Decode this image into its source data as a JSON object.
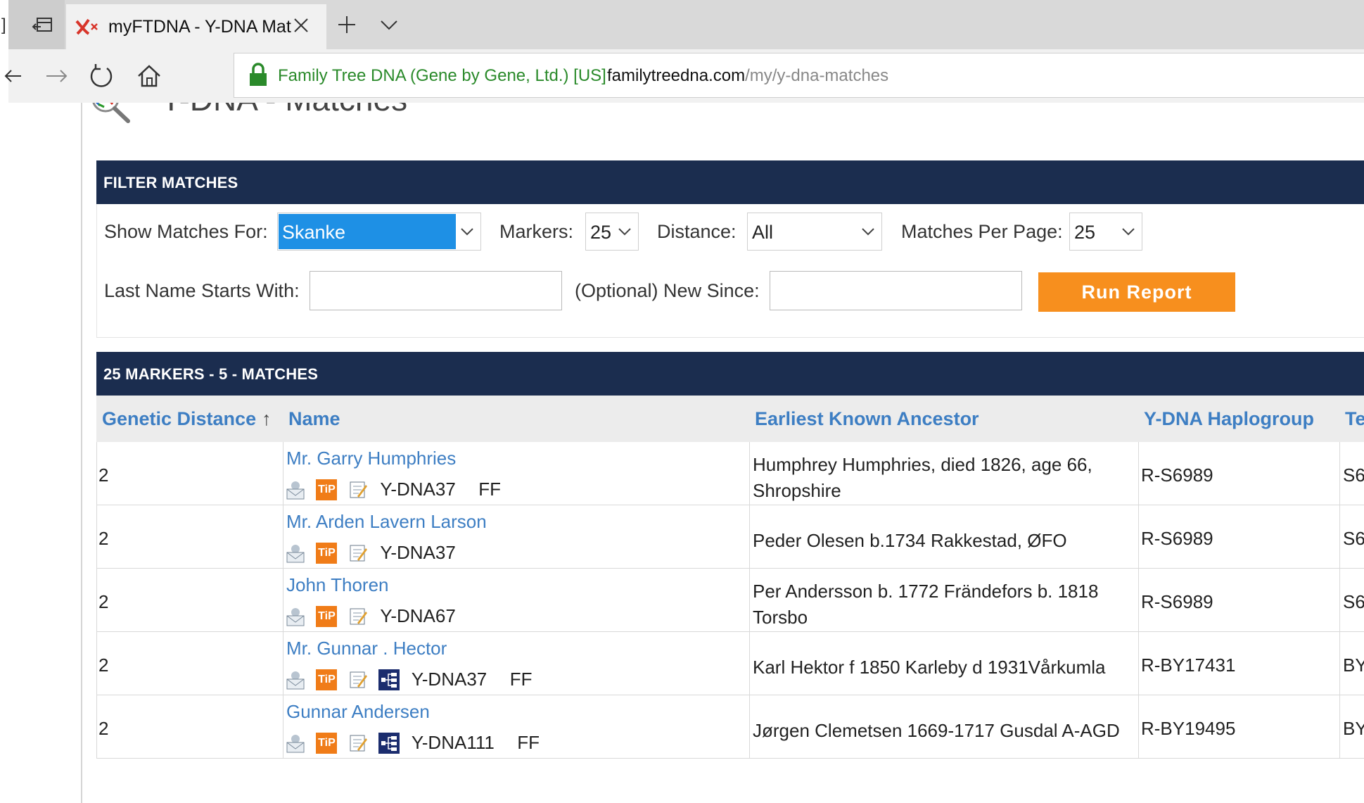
{
  "browser": {
    "tab_title": "myFTDNA - Y-DNA Mat",
    "site_identity": "Family Tree DNA (Gene by Gene, Ltd.) [US]",
    "url_host": "familytreedna.com",
    "url_path": "/my/y-dna-matches"
  },
  "page": {
    "heading_fragment": "Y-DNA - Matches"
  },
  "filter": {
    "title": "FILTER MATCHES",
    "show_matches_label": "Show Matches For:",
    "show_matches_value": "Skanke",
    "markers_label": "Markers:",
    "markers_value": "25",
    "distance_label": "Distance:",
    "distance_value": "All",
    "per_page_label": "Matches Per Page:",
    "per_page_value": "25",
    "last_name_label": "Last Name Starts With:",
    "last_name_value": "",
    "new_since_label": "(Optional) New Since:",
    "new_since_value": "",
    "run_label": "Run Report"
  },
  "results": {
    "title": "25 MARKERS - 5 - MATCHES",
    "columns": {
      "genetic_distance": "Genetic Distance",
      "sort_indicator": "↑",
      "name": "Name",
      "eka": "Earliest Known Ancestor",
      "haplogroup": "Y-DNA Haplogroup",
      "terminal_snp": "Te"
    },
    "rows": [
      {
        "gd": "2",
        "name": "Mr. Garry Humphries",
        "kit": "Y-DNA37",
        "ff": "FF",
        "eka": "Humphrey Humphries, died 1826, age 66, Shropshire",
        "haplogroup": "R-S6989",
        "te": "S6"
      },
      {
        "gd": "2",
        "name": "Mr. Arden Lavern Larson",
        "kit": "Y-DNA37",
        "ff": "",
        "eka": "Peder Olesen b.1734 Rakkestad, ØFO",
        "haplogroup": "R-S6989",
        "te": "S6"
      },
      {
        "gd": "2",
        "name": "John Thoren",
        "kit": "Y-DNA67",
        "ff": "",
        "eka": "Per Andersson b. 1772 Frändefors b. 1818 Torsbo",
        "haplogroup": "R-S6989",
        "te": "S6"
      },
      {
        "gd": "2",
        "name": "Mr. Gunnar . Hector",
        "kit": "Y-DNA37",
        "ff": "FF",
        "eka": "Karl Hektor f 1850 Karleby d 1931Vårkumla",
        "haplogroup": "R-BY17431",
        "te": "BY"
      },
      {
        "gd": "2",
        "name": "Gunnar Andersen",
        "kit": "Y-DNA111",
        "ff": "FF",
        "eka": "Jørgen Clemetsen 1669-1717 Gusdal A-AGD",
        "haplogroup": "R-BY19495",
        "te": "BY"
      }
    ]
  }
}
